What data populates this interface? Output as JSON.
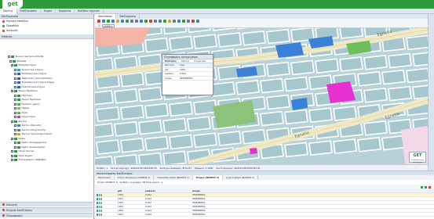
{
  "app": {
    "logo_text": "get",
    "brand_color": "#2f9a3a"
  },
  "menubar": {
    "items": [
      "Χάρτης",
      "Επεξεργασία",
      "Χώροι",
      "Εργαλεία",
      "Βοήθεια Αρχείου"
    ]
  },
  "left_panel": {
    "header": "Επεξεργασία",
    "rows": [
      {
        "label": "Επιλογή επιπέδου",
        "color": "#d93a2b"
      },
      {
        "label": "Προσθήκη",
        "color": "#2f9a3a"
      },
      {
        "label": "Ακύρωση",
        "color": "#d93a2b"
      }
    ],
    "sub_header": "Επίπεδα",
    "tree": [
      {
        "label": "Συγκεντρωτικά επίπεδα",
        "swatch": "#2f9a3a",
        "indent": 10
      },
      {
        "label": "Επίπεδα",
        "swatch": "#2f9a3a",
        "indent": 12
      },
      {
        "label": "Εκπαιδευτήρια",
        "swatch": "#2f9a3a",
        "indent": 14
      },
      {
        "label": "Διοικητικά κτήρια",
        "swatch": "#3aa0d8",
        "indent": 18
      },
      {
        "label": "Εκπαιδευτικά κτήρια",
        "swatch": "#2f5fb5",
        "indent": 18
      },
      {
        "label": "Αθλητικές εγκαταστάσεις",
        "swatch": "#2f5fb5",
        "indent": 18
      },
      {
        "label": "Εκπαιδευτικά κτήρια δήμου",
        "swatch": "#2f5fb5",
        "indent": 18
      },
      {
        "label": "Πολιτιστικά κτήρια",
        "swatch": "#2f5fb5",
        "indent": 18
      },
      {
        "label": "Χώροι Πρασίνου",
        "swatch": "#2f9a3a",
        "indent": 14
      },
      {
        "label": "Πλατείες",
        "swatch": "#2f9a3a",
        "indent": 18
      },
      {
        "label": "Χώροι Πρασίνου",
        "swatch": "#2f9a3a",
        "indent": 18
      },
      {
        "label": "Παιδικές χαρές",
        "swatch": "#4fb84a",
        "indent": 18
      },
      {
        "label": "Πάρκα",
        "swatch": "#8ac34a",
        "indent": 18
      },
      {
        "label": "Άλση",
        "swatch": "#4fb84a",
        "indent": 18
      },
      {
        "label": "Κοιμητήρια",
        "swatch": "#9a4fa0",
        "indent": 18
      },
      {
        "label": "Δίκτυα",
        "swatch": "#2f9a3a",
        "indent": 14
      },
      {
        "label": "Δίκτυο ύδρευσης",
        "swatch": "#3a7fd0",
        "indent": 18
      },
      {
        "label": "Δίκτυο αποχέτευσης",
        "swatch": "#3a7fd0",
        "indent": 18
      },
      {
        "label": "Δίκτυο ηλεκτροφωτισμού",
        "swatch": "#d9a62b",
        "indent": 18
      },
      {
        "label": "Κάδοι",
        "swatch": "#2f9a3a",
        "indent": 14
      },
      {
        "label": "Κάδοι απορριμμάτων",
        "swatch": "#2f9a3a",
        "indent": 18
      },
      {
        "label": "Κάδοι ανακύκλωσης",
        "swatch": "#2f9a3a",
        "indent": 18
      },
      {
        "label": "Οδικό δίκτυο",
        "swatch": "#2f9a3a",
        "indent": 14
      },
      {
        "label": "Όρια Δήμου",
        "swatch": "#2f9a3a",
        "indent": 14
      },
      {
        "label": "Τοπογραφικό υπόβαθρο",
        "swatch": "#2f9a3a",
        "indent": 14
      }
    ],
    "bottom_items": [
      "Επιλογές",
      "Κείμενα Αναζήτησης",
      "Πληροφορίες"
    ]
  },
  "map_panel": {
    "tabs": [
      "Αποτύπωση",
      "Επεξεργασία"
    ],
    "scale_label": "1:",
    "scale_value": "[1000]",
    "status_items": [
      "Πλήθος: 1",
      "Κέντρο περιοχής: 409145.88 4501230.25",
      "Σύστημα αναφοράς: ΕΓΣΑ 87",
      "Κλίμακα: 1:1000",
      "Συντεταγμένες: 409145.88 4501230.25"
    ]
  },
  "popup": {
    "title": "Πληροφορίες Αντικειμένου",
    "tabs": [
      "Ιδιότητες",
      "Χάρτης",
      "Γεωμετρία"
    ],
    "rows": [
      {
        "key": "Ιδιότητα",
        "value": "Τιμή"
      },
      {
        "key": "gid",
        "value": "1050"
      },
      {
        "key": "κωδικός",
        "value": "0.002"
      },
      {
        "key": "όνομα",
        "value": "ΠΕΡΙΦΕΡΕΙΑ"
      }
    ]
  },
  "bottom_panel": {
    "header": "Αποτελέσματα Αναζήτησης",
    "tabs": [
      "Εργασιακά",
      "Κτίρια Διοίκησης (ΝΟΜΟΣ 1)",
      "Πολλαπλά πεδία (ΝΟΜΟΣ 1)",
      "Κτίρια (ΝΟΜΟΣ 1)",
      "Αγροτεμάχια (ΝΟΜΟΣ 1)"
    ],
    "active_tab": 3,
    "info": "Κτίρια (ΝΟΜΟΣ 1): Αριθμός εγγραφών: 38 Επιλεγμένες: 1",
    "columns": [
      "gid",
      "κωδικός",
      "όνομα"
    ],
    "rows": [
      {
        "gid": "1050",
        "code": "0.002",
        "name": "ΠΕΡΙΦΕΡΕΙΑ"
      },
      {
        "gid": "1051",
        "code": "0.002",
        "name": "ΠΕΡΙΦΕΡΕΙΑ"
      },
      {
        "gid": "1052",
        "code": "0.002",
        "name": "ΠΕΡΙΦΕΡΕΙΑ"
      },
      {
        "gid": "1053",
        "code": "0.002",
        "name": "ΠΕΡΙΦΕΡΕΙΑ"
      },
      {
        "gid": "1054",
        "code": "0.002",
        "name": "ΠΕΡΙΦΕΡΕΙΑ"
      },
      {
        "gid": "1055",
        "code": "0.002",
        "name": "ΠΕΡΙΦΕΡΕΙΑ"
      }
    ]
  },
  "corner_logo": {
    "text": "GET",
    "sub": "GeoEngineering Technologies"
  },
  "street_labels": [
    "Egnatia",
    "Egnatia",
    "Egnatia"
  ]
}
